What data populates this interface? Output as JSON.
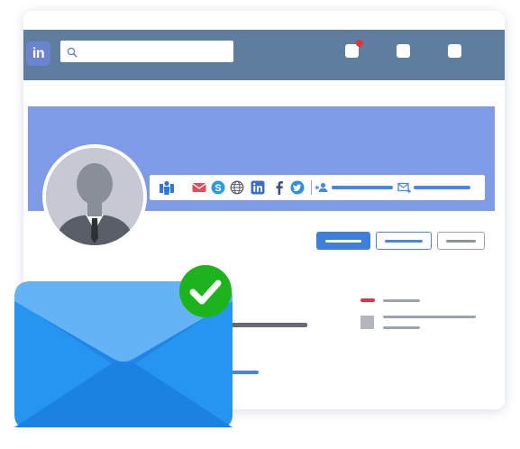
{
  "app": {
    "logo_text": "in",
    "brand_color": "#6c84cf",
    "topbar_color": "#5f7d9f",
    "cover_color": "#7f9be6"
  },
  "search": {
    "placeholder": "",
    "value": ""
  },
  "icons": {
    "topbar": [
      "search-icon",
      "notification-icon",
      "messages-icon",
      "account-icon"
    ],
    "contact": [
      "person-icon",
      "email-icon",
      "skype-icon",
      "globe-icon",
      "linkedin-icon",
      "facebook-icon",
      "twitter-icon",
      "add-connection-icon",
      "message-icon"
    ],
    "overlay": [
      "envelope-icon",
      "checkmark-icon"
    ]
  },
  "status": {
    "notification_color": "#e2333e",
    "success_color": "#1db31d",
    "tag_color": "#e2333e"
  }
}
